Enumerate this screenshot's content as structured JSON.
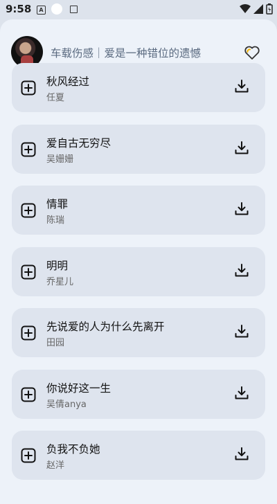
{
  "status_bar": {
    "time": "9:58",
    "a_icon_letter": "A"
  },
  "header": {
    "title": "车载伤感｜爱是一种错位的遗憾"
  },
  "songs": [
    {
      "title": "秋风经过",
      "artist": "任夏"
    },
    {
      "title": "爱自古无穷尽",
      "artist": "吴姗姗"
    },
    {
      "title": "情罪",
      "artist": "陈瑞"
    },
    {
      "title": "明明",
      "artist": "乔星儿"
    },
    {
      "title": "先说爱的人为什么先离开",
      "artist": "田园"
    },
    {
      "title": "你说好这一生",
      "artist": "吴倩anya"
    },
    {
      "title": "负我不负她",
      "artist": "赵洋"
    }
  ],
  "colors": {
    "background": "#dde3ec",
    "sheet": "#edf2f9",
    "card": "#dee4ee",
    "heart_outline": "#333333",
    "heart_accent": "#f4b400"
  }
}
